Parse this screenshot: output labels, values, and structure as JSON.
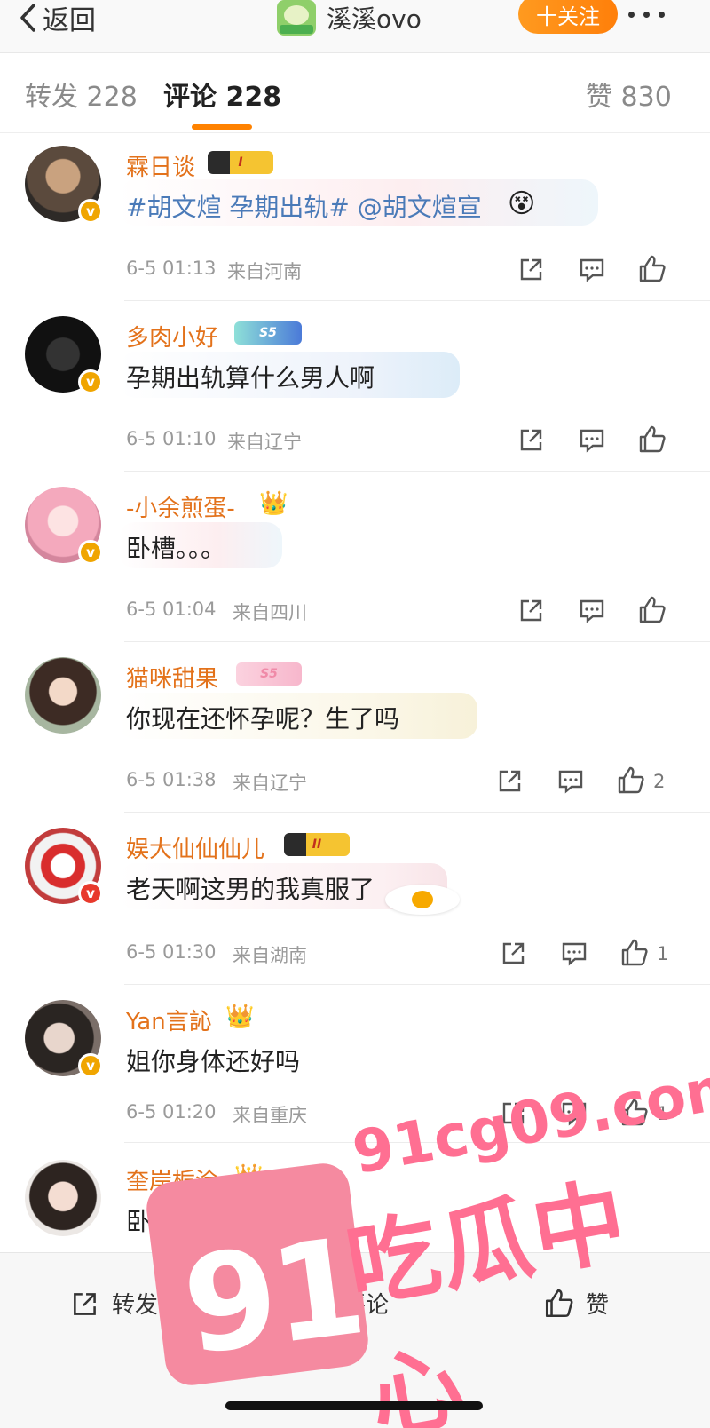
{
  "nav": {
    "back_label": "返回",
    "title": "溪溪ovo",
    "follow_label": "十关注"
  },
  "tabs": {
    "repost": "转发 228",
    "comment": "评论 228",
    "like": "赞 830"
  },
  "comments": [
    {
      "user": "霖日谈",
      "badge": "I",
      "text": "#胡文煊 孕期出轨# @胡文煊宣",
      "time": "6-5 01:13",
      "location": "来自河南",
      "likes": ""
    },
    {
      "user": "多肉小好",
      "badge": "S5",
      "text": "孕期出轨算什么男人啊",
      "time": "6-5 01:10",
      "location": "来自辽宁",
      "likes": ""
    },
    {
      "user": "-小余煎蛋-",
      "badge": "",
      "text": "卧槽。。。",
      "time": "6-5 01:04",
      "location": "来自四川",
      "likes": ""
    },
    {
      "user": "猫咪甜果",
      "badge": "S5",
      "text": "你现在还怀孕呢？生了吗",
      "time": "6-5 01:38",
      "location": "来自辽宁",
      "likes": "2"
    },
    {
      "user": "娱大仙仙仙儿",
      "badge": "II",
      "text": "老天啊这男的我真服了",
      "time": "6-5 01:30",
      "location": "来自湖南",
      "likes": "1"
    },
    {
      "user": "Yan言訫",
      "badge": "",
      "text": "姐你身体还好吗",
      "time": "6-5 01:20",
      "location": "来自重庆",
      "likes": "1"
    },
    {
      "user": "奎岸栀涂",
      "badge": "",
      "text": "卧槽",
      "time": "",
      "location": "",
      "likes": ""
    }
  ],
  "bottom_bar": {
    "repost": "转发",
    "comment": "评论",
    "like": "赞"
  },
  "watermark": {
    "number": "91",
    "domain": "91cg09.com",
    "name": "吃瓜中心"
  },
  "colors": {
    "accent": "#ff8200",
    "username": "#e3721b",
    "verified_orange": "#f0a500",
    "verified_red": "#e8392c",
    "watermark": "#ff6f92"
  }
}
